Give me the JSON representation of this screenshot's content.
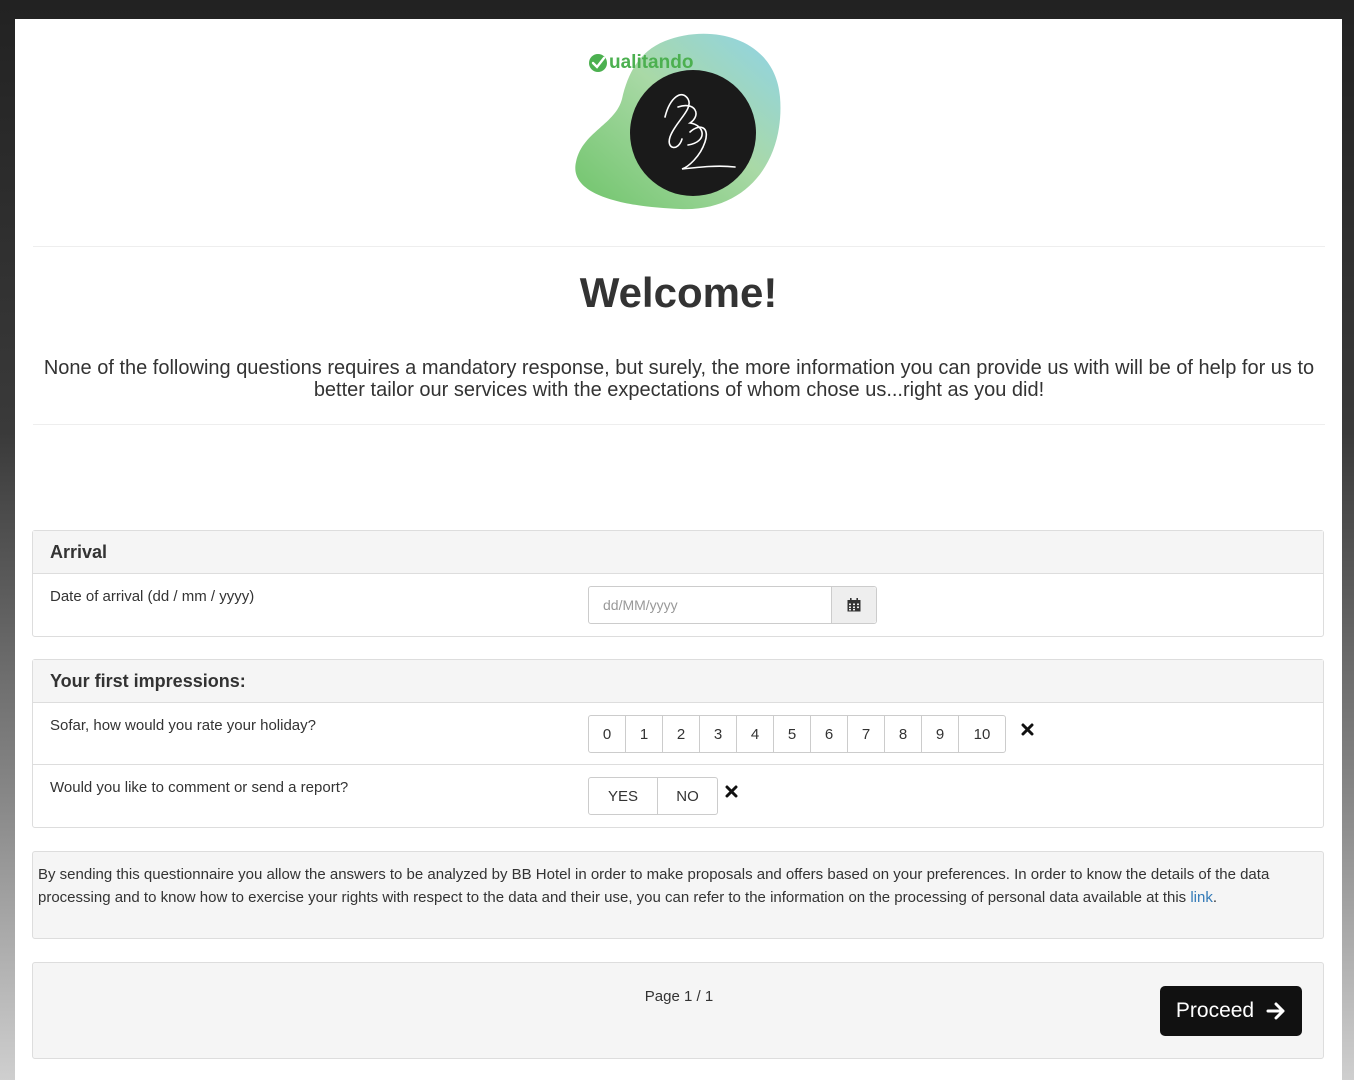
{
  "header": {
    "brand_text": "ualitando",
    "logo_monogram": "BB"
  },
  "welcome": {
    "title": "Welcome!",
    "intro": "None of the following questions requires a mandatory response, but surely, the more information you can provide us with will be of help for us to better tailor our services with the expectations of whom chose us...right  as you did!"
  },
  "arrival": {
    "heading": "Arrival",
    "date_label": "Date of arrival (dd / mm / yyyy)",
    "date_value": "",
    "date_placeholder": "dd/MM/yyyy"
  },
  "impressions": {
    "heading": "Your first impressions:",
    "rating_question": "Sofar, how would you rate your holiday?",
    "rating_options": [
      "0",
      "1",
      "2",
      "3",
      "4",
      "5",
      "6",
      "7",
      "8",
      "9",
      "10"
    ],
    "comment_question": "Would you like to comment or send a report?",
    "comment_options": [
      "YES",
      "NO"
    ]
  },
  "privacy": {
    "text": "By sending this questionnaire you allow the answers to be analyzed by BB Hotel in order to make proposals and offers based on your preferences.  In order to know the details of the data processing and to know how to exercise your rights with respect to the data and their use, you can refer to the information on the processing of personal data available at this ",
    "link_text": "link",
    "tail": "."
  },
  "footer": {
    "page_indicator": "Page 1 / 1",
    "proceed_label": "Proceed"
  },
  "icons": {
    "calendar": "calendar-icon",
    "clear": "close-icon",
    "arrow": "arrow-right-icon"
  },
  "colors": {
    "brand_green": "#4cb050",
    "brand_teal": "#8fd3e8",
    "link": "#337ab7",
    "primary_button": "#111111"
  }
}
